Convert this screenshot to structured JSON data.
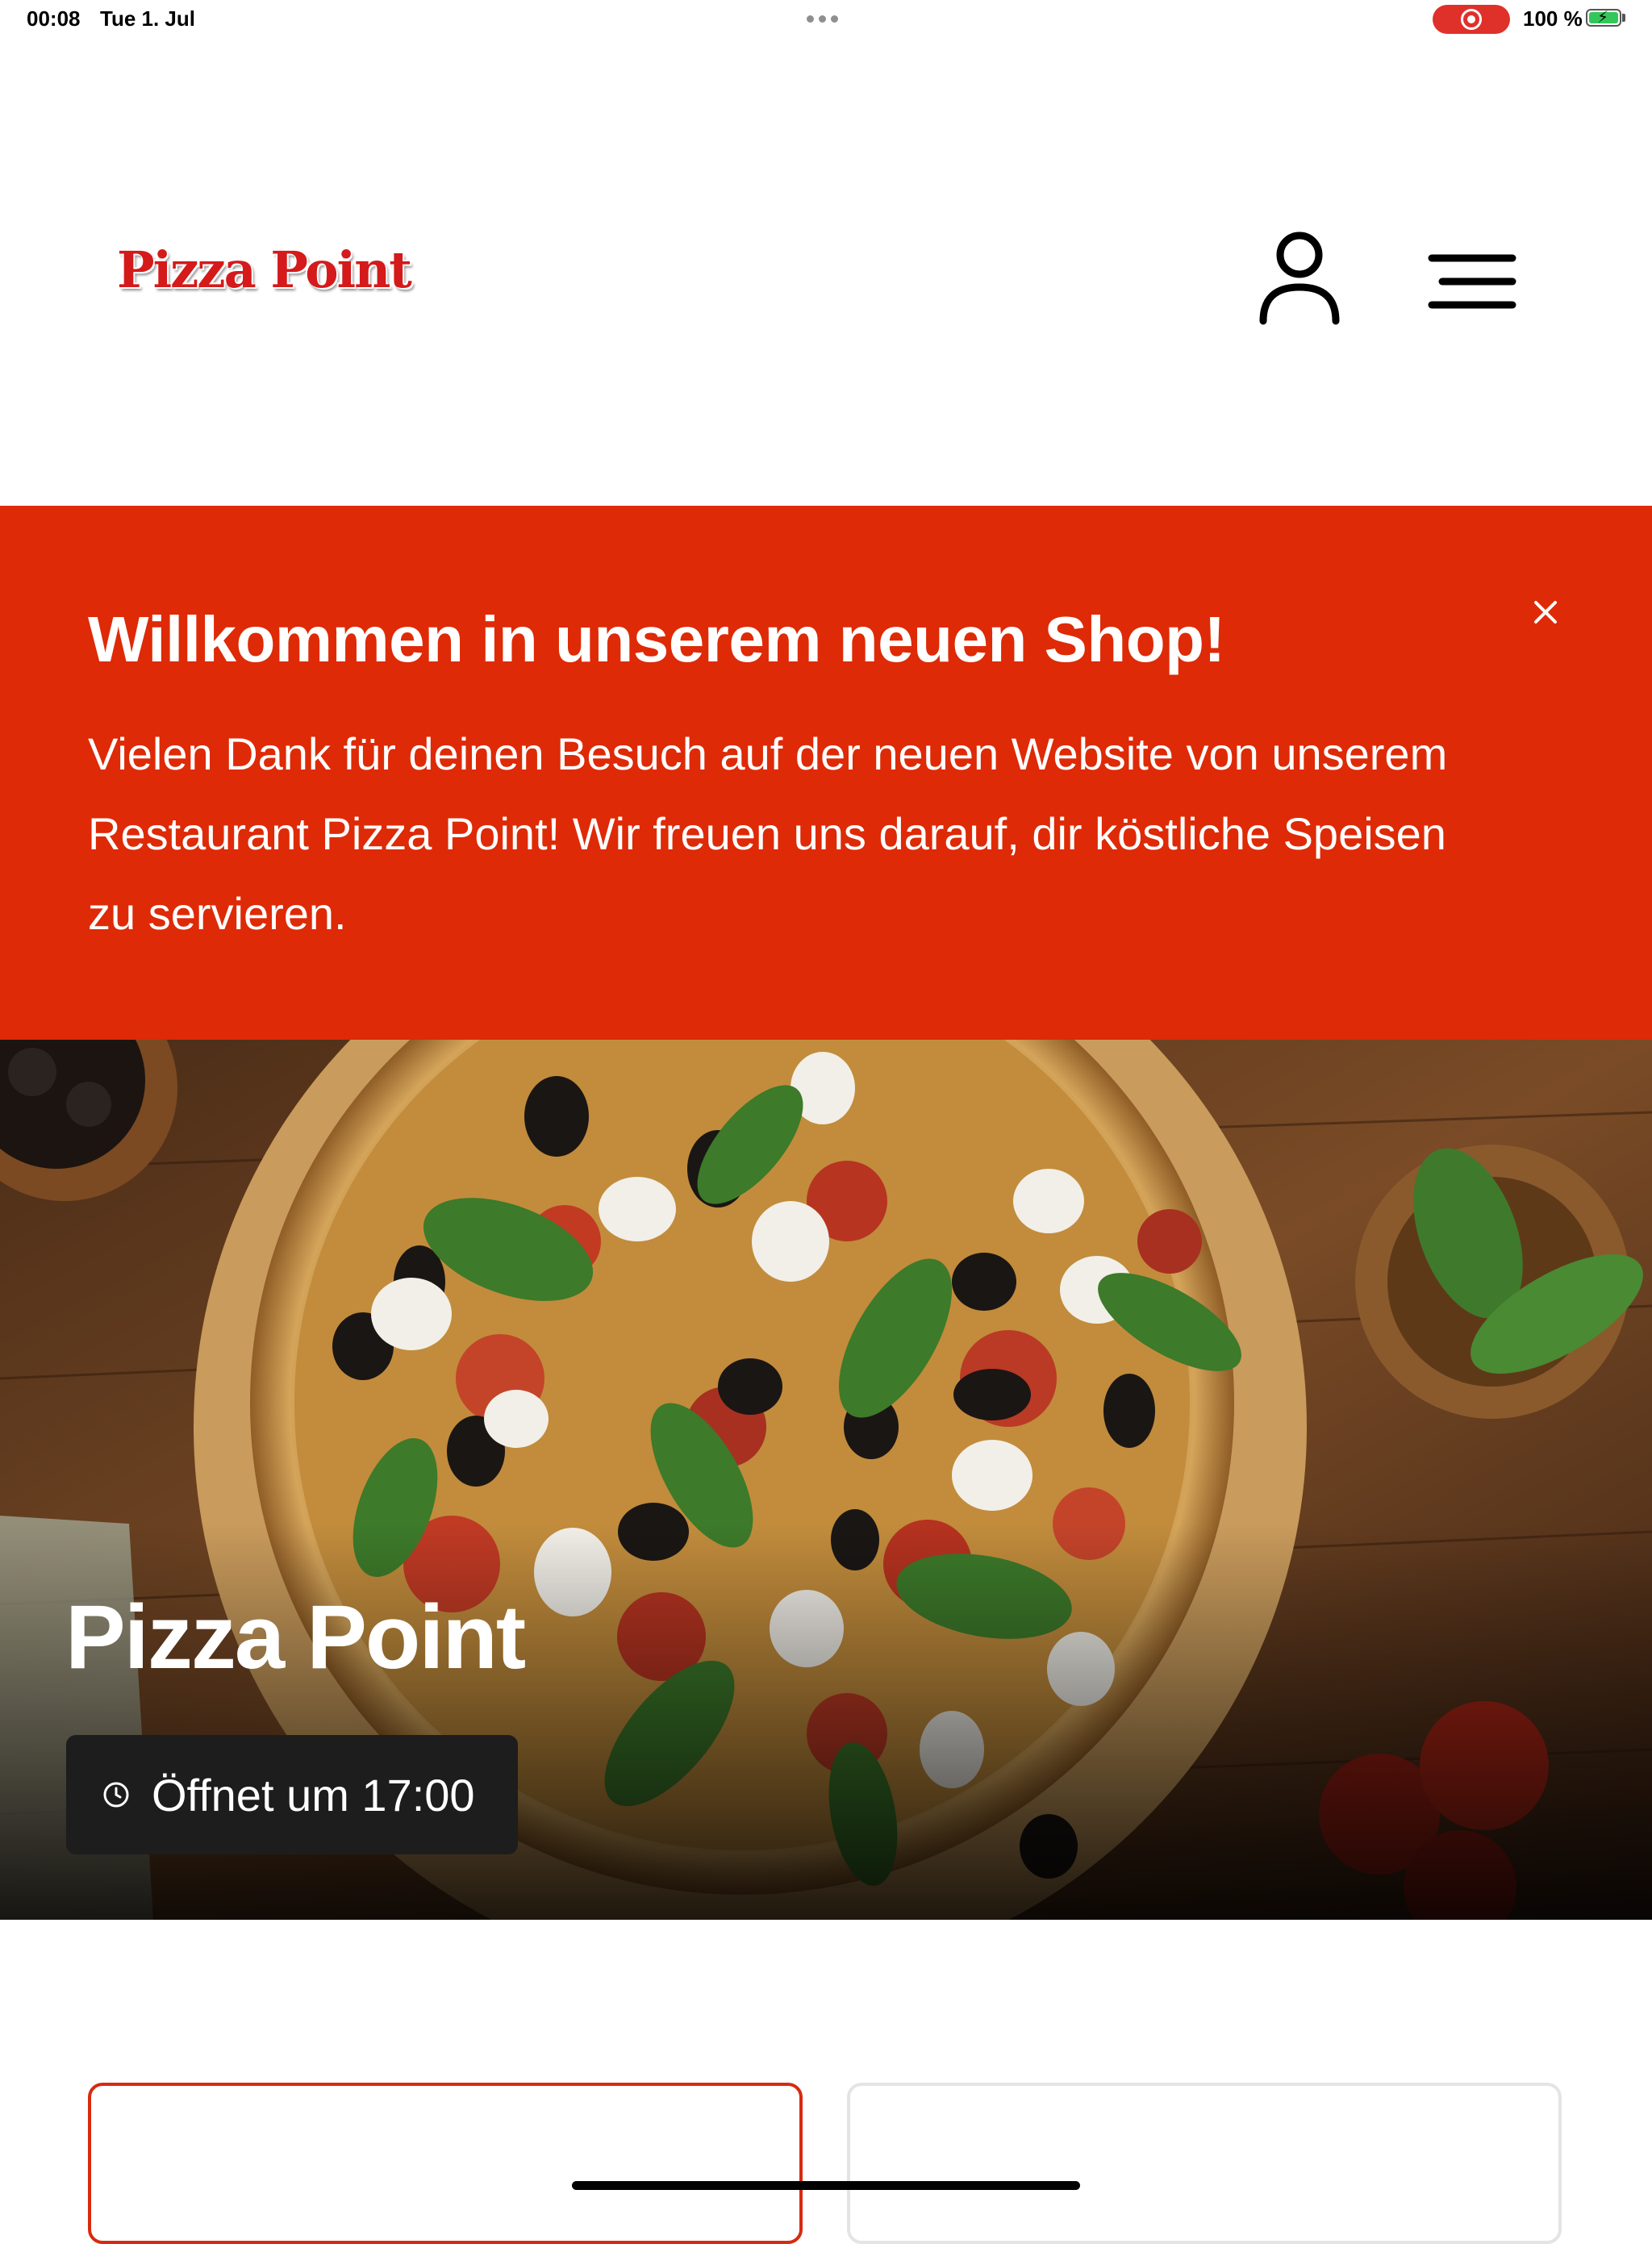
{
  "status_bar": {
    "time": "00:08",
    "date": "Tue 1. Jul",
    "battery": "100 %"
  },
  "header": {
    "logo_text": "Pizza Point",
    "icons": [
      "user-icon",
      "hamburger-menu-icon"
    ]
  },
  "banner": {
    "title": "Willkommen in unserem neuen Shop!",
    "text": "Vielen Dank für deinen Besuch auf der neuen Website von unserem Restaurant Pizza Point! Wir freuen uns darauf, dir köstliche Speisen zu servieren.",
    "close_icon": "close-icon",
    "background_color": "#de2a06"
  },
  "hero": {
    "title": "Pizza Point",
    "opening_status": "Öffnet um 17:00",
    "icon": "clock-icon"
  },
  "colors": {
    "accent": "#de2a06",
    "logo_red": "#d41a1a"
  }
}
